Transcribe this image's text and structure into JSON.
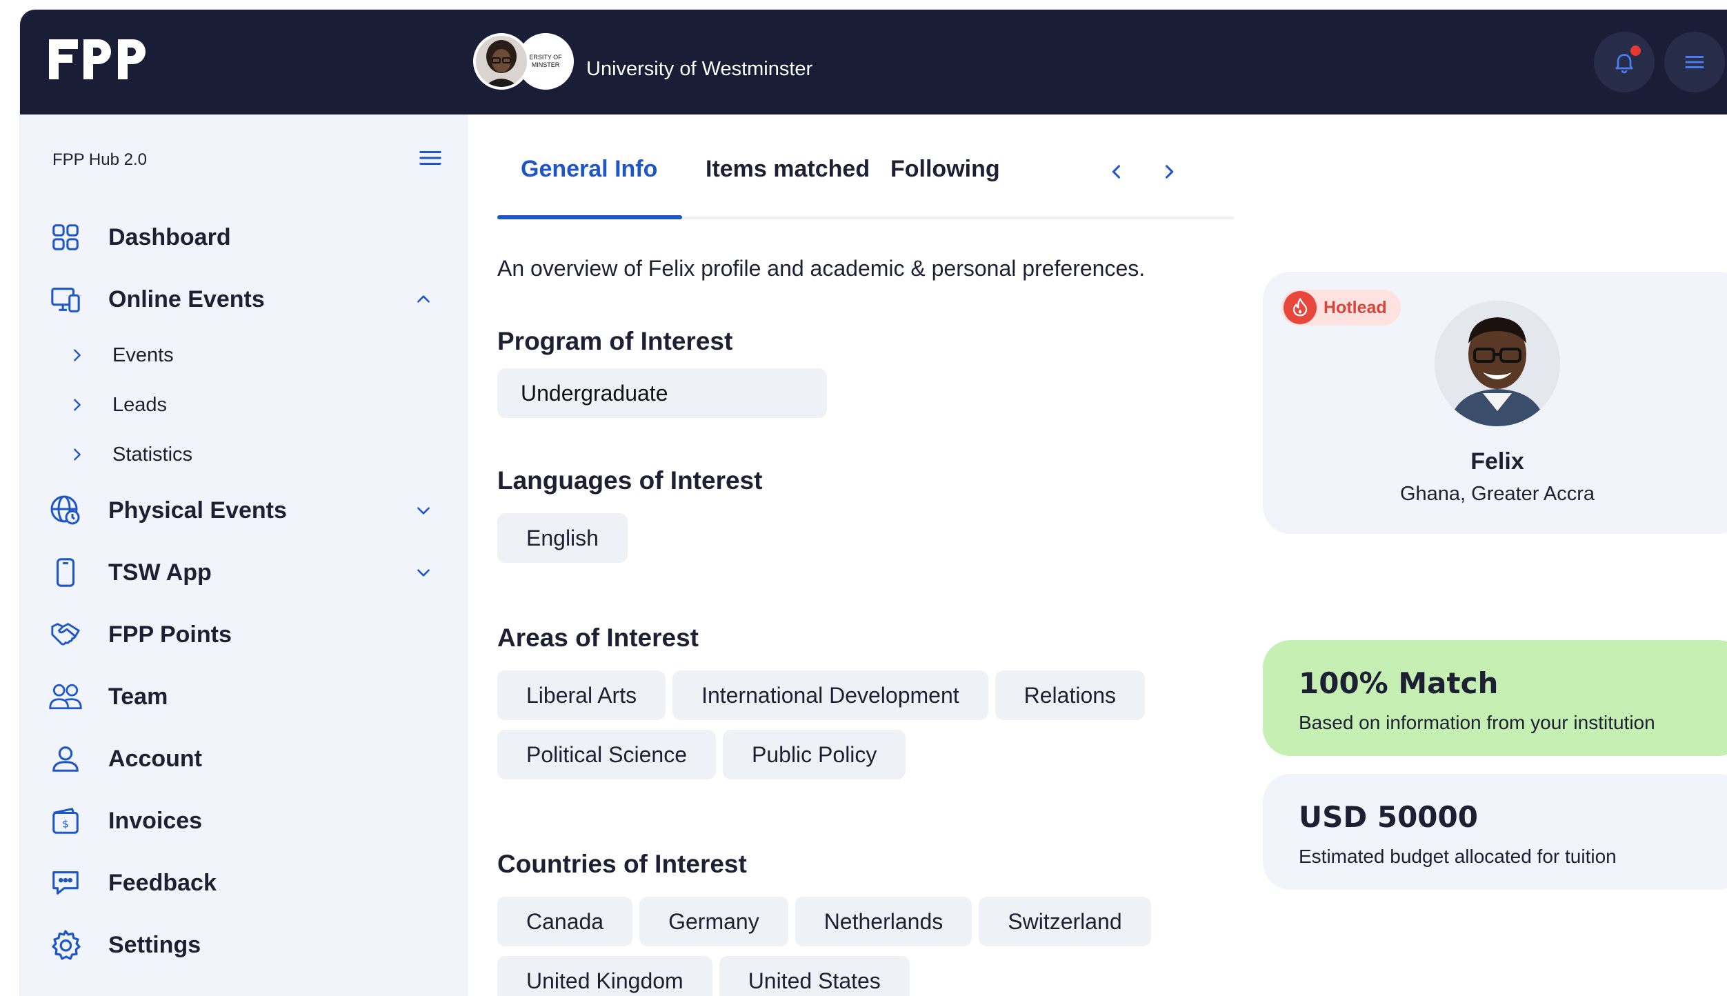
{
  "header": {
    "logo_text": "FPP",
    "institution": "University of Westminster",
    "institution_logo_text": "UNIVERSITY OF WESTMINSTER"
  },
  "sidebar": {
    "title": "FPP Hub 2.0",
    "items": [
      {
        "label": "Dashboard",
        "icon": "dashboard-grid-icon"
      },
      {
        "label": "Online Events",
        "icon": "devices-icon",
        "expanded": true,
        "children": [
          {
            "label": "Events"
          },
          {
            "label": "Leads"
          },
          {
            "label": "Statistics"
          }
        ]
      },
      {
        "label": "Physical Events",
        "icon": "globe-icon",
        "expanded": false
      },
      {
        "label": "TSW App",
        "icon": "phone-icon",
        "expanded": false
      },
      {
        "label": "FPP Points",
        "icon": "handshake-icon"
      },
      {
        "label": "Team",
        "icon": "team-icon"
      },
      {
        "label": "Account",
        "icon": "user-icon"
      },
      {
        "label": "Invoices",
        "icon": "invoice-icon"
      },
      {
        "label": "Feedback",
        "icon": "chat-icon"
      },
      {
        "label": "Settings",
        "icon": "gear-icon"
      }
    ]
  },
  "tabs": [
    {
      "label": "General Info",
      "active": true
    },
    {
      "label": "Items matched",
      "active": false
    },
    {
      "label": "Following",
      "active": false
    }
  ],
  "main": {
    "overview": "An overview of Felix profile and academic & personal preferences.",
    "program": {
      "title": "Program of Interest",
      "value": "Undergraduate"
    },
    "languages": {
      "title": "Languages of Interest",
      "values": [
        "English"
      ]
    },
    "areas": {
      "title": "Areas of Interest",
      "values": [
        "Liberal Arts",
        "International Development",
        "Relations",
        "Political Science",
        "Public Policy"
      ]
    },
    "countries": {
      "title": "Countries of Interest",
      "values": [
        "Canada",
        "Germany",
        "Netherlands",
        "Switzerland",
        "United Kingdom",
        "United States"
      ]
    }
  },
  "profile": {
    "badge": "Hotlead",
    "name": "Felix",
    "location": "Ghana, Greater Accra"
  },
  "match": {
    "headline": "100% Match",
    "detail": "Based on information from your institution"
  },
  "budget": {
    "headline": "USD 50000",
    "detail": "Estimated budget allocated for tuition"
  },
  "colors": {
    "accent": "#1e56c8",
    "topbar": "#191d35",
    "sidebar": "#f1f4fa",
    "match": "#c6efb3",
    "hotlead": "#e8473c"
  }
}
